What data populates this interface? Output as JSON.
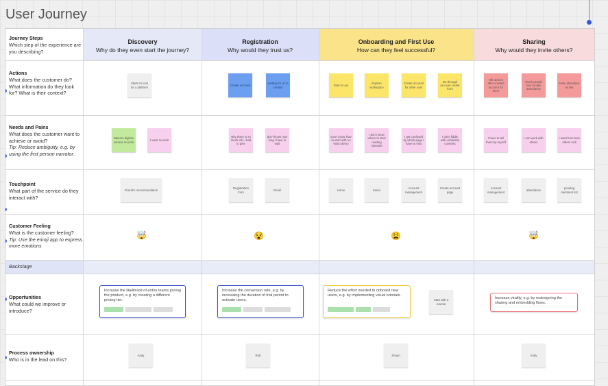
{
  "title": "User Journey",
  "columns": [
    {
      "name": "Discovery",
      "question": "Why do they even start the journey?",
      "color": "#e5e8f7"
    },
    {
      "name": "Registration",
      "question": "Why would they trust us?",
      "color": "#dbe0f8"
    },
    {
      "name": "Onboarding and First Use",
      "question": "How can they feel successful?",
      "color": "#fbe38a"
    },
    {
      "name": "Sharing",
      "question": "Why would they invite others?",
      "color": "#f8dcdd"
    }
  ],
  "rows": [
    {
      "name": "Journey Steps",
      "desc": "Which step of the experience are you describing?",
      "tip": ""
    },
    {
      "name": "Actions",
      "desc": "What does the customer do? What information do they look for? What is their context?",
      "tip": ""
    },
    {
      "name": "Needs and Pains",
      "desc": "What does the customer want to achieve or avoid?",
      "tip": "Tip: Reduce ambiguity, e.g. by using the first person narrator."
    },
    {
      "name": "Touchpoint",
      "desc": "What part of the service do they interact with?",
      "tip": ""
    },
    {
      "name": "Customer Feeling",
      "desc": "What is the customer feeling?",
      "tip": "Tip: Use the emoji app to express more emotions"
    },
    {
      "name": "Backstage",
      "desc": "",
      "tip": ""
    },
    {
      "name": "Opportunities",
      "desc": "What could we improve or introduce?",
      "tip": ""
    },
    {
      "name": "Process ownership",
      "desc": "Who is in the lead on this?",
      "tip": ""
    }
  ],
  "actions": [
    [
      "Starts to look for a platform"
    ],
    [
      "Create account",
      "waiting for us to contact"
    ],
    [
      "Start in use",
      "Explore workspace",
      "Create account for other user",
      "Do through account create form"
    ],
    [
      "Tell desires after created account for them",
      "Teach people how to take attendance",
      "Invite attendees as link"
    ]
  ],
  "needs": [
    [
      "Want to digitize various records",
      "I want records"
    ],
    [
      "why there is so much info I had to give",
      "don't know how long I have to wait"
    ],
    [
      "Don't know how to start with no video demo",
      "I don't know where to start reading manuals",
      "I get confused by which page I have to visit",
      "I don't fiddle with unfamiliar contents"
    ],
    [
      "I have to tell them by myself",
      "I can work with others",
      "I want from how others visit"
    ]
  ],
  "touchpoints": [
    [
      "Friend's recommendation"
    ],
    [
      "Registration form",
      "Email"
    ],
    [
      "Home",
      "Items",
      "Account management",
      "Create account page"
    ],
    [
      "Account management",
      "attendance",
      "pending members list"
    ]
  ],
  "feelings": [
    "🤯",
    "😵",
    "😩",
    "🤯"
  ],
  "opportunities": [
    "Increase the likelihood of entire teams joining the product, e.g. by creating a different pricing tier.",
    "Increase the conversion rate, e.g. by increasing the duration of trial period to activate users.",
    "Reduce the effort needed to onboard new users, e.g. by implementing visual tutorials.",
    "Increase virality, e.g. by redesigning the sharing and embedding flows."
  ],
  "opp_extra_note": "Start with a tutorial",
  "owners": [
    "Andy",
    "Rob",
    "Shaun",
    "Andy"
  ]
}
